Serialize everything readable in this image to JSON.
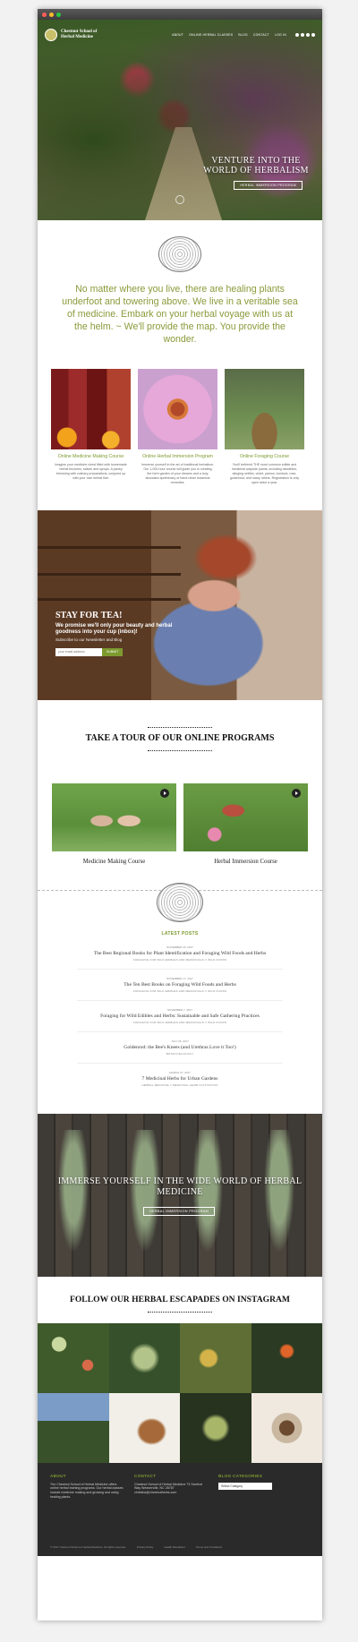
{
  "window": {
    "title": "Chestnut School of Herbal Medicine"
  },
  "nav": {
    "logo": "Chestnut School of Herbal Medicine",
    "items": [
      "ABOUT",
      "ONLINE HERBAL CLASSES",
      "BLOG",
      "CONTACT",
      "LOG IN"
    ]
  },
  "hero": {
    "title": "VENTURE INTO THE WORLD OF HERBALISM",
    "button": "HERBAL IMMERSION PROGRAM"
  },
  "intro": "No matter where you live, there are healing plants underfoot and towering above. We live in a veritable sea of medicine. Embark on your herbal voyage with us at the helm. ~ We'll provide the map.  You provide the wonder.",
  "courses": [
    {
      "title": "Online Medicine Making Course",
      "desc": "Imagine your medicine chest filled with homemade herbal tinctures, salves and syrups. A pantry brimming with culinary preparations, conjured up with your own herbal flair."
    },
    {
      "title": "Online Herbal Immersion Program",
      "desc": "Immerse yourself in the art of traditional herbalism. Our 1,000-hour course will guide you in creating the herb garden of your dreams and a truly abundant apothecary of hand-hewn botanical remedies."
    },
    {
      "title": "Online Foraging Course",
      "desc": "You'll befriend THE most common edible and medicinal wayside plants, including dandelion, stinging nettles, violet, yarrow, burdock, rose, goldenrod, and many others. Registration is only open twice a year."
    }
  ],
  "tea": {
    "title": "STAY FOR TEA!",
    "subtitle": "We promise we'll only pour beauty and herbal goodness into your cup (inbox)!",
    "line": "Subscribe to our Newsletter and Blog",
    "placeholder": "your email address",
    "button": "SUBMIT"
  },
  "tour": {
    "title": "TAKE A TOUR OF OUR ONLINE PROGRAMS",
    "videos": [
      "Medicine Making Course",
      "Herbal Immersion Course"
    ]
  },
  "posts": {
    "heading": "LATEST POSTS",
    "items": [
      {
        "date": "NOVEMBER 20, 2017",
        "title": "The Best Regional Books for Plant Identification and Foraging Wild Foods and Herbs",
        "cat": "FORAGING FOR WILD EDIBLES AND MEDICINALS // WILD FOODS"
      },
      {
        "date": "NOVEMBER 17, 2017",
        "title": "The Ten Best Books on Foraging Wild Foods and Herbs",
        "cat": "FORAGING FOR WILD EDIBLES AND MEDICINALS // WILD FOODS"
      },
      {
        "date": "NOVEMBER 7, 2017",
        "title": "Foraging for Wild Edibles and Herbs: Sustainable and Safe Gathering Practices",
        "cat": "FORAGING FOR WILD EDIBLES AND MEDICINALS // WILD FOODS"
      },
      {
        "date": "JULY 25, 2017",
        "title": "Goldenrod: the Bee's Knees (and Urethras Love it Too!)",
        "cat": "BOTANY/ECOLOGY"
      },
      {
        "date": "MARCH 27, 2017",
        "title": "7 Medicinal Herbs for Urban Gardens",
        "cat": "HERBAL MEDICINE // MEDICINAL HERB CULTIVATION"
      }
    ]
  },
  "immerse": {
    "title": "IMMERSE YOURSELF IN THE WIDE WORLD OF HERBAL MEDICINE",
    "button": "HERBAL IMMERSION PROGRAM"
  },
  "instagram": {
    "title": "FOLLOW OUR HERBAL ESCAPADES ON INSTAGRAM"
  },
  "footer": {
    "about_h": "ABOUT",
    "about_t": "The Chestnut School of Herbal Medicine offers online herbal training programs. Our herbal classes include medicine making and growing and using healing plants.",
    "contact_h": "CONTACT",
    "contact_t": "Chestnut School of Herbal Medicine 73 Sanford Way Weaverville, NC 28787 christina@chestnutherbs.com",
    "cat_h": "BLOG CATEGORIES",
    "cat_select": "Select Category",
    "copyright": "© 2017 Chestnut School of Herbal Medicine. All rights reserved.",
    "links": [
      "Privacy Policy",
      "Health Disclaimer",
      "Terms and Conditions"
    ]
  }
}
